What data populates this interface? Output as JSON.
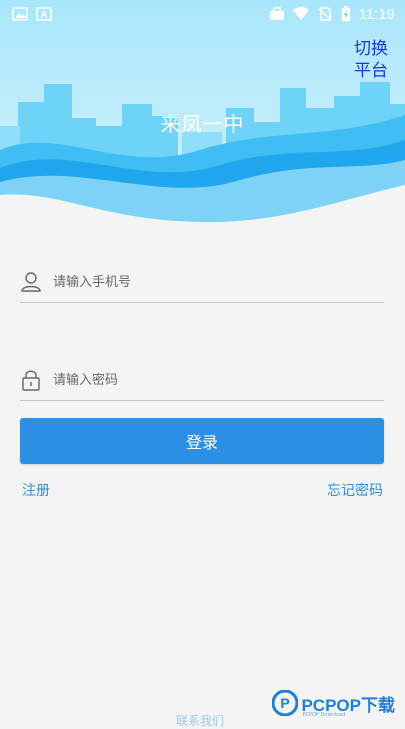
{
  "status_bar": {
    "time": "11:19",
    "icons": [
      "image-icon",
      "a-notification-icon",
      "briefcase-icon",
      "wifi-icon",
      "no-sim-icon",
      "battery-charging-icon"
    ]
  },
  "header": {
    "title": "来凤一中",
    "switch_platform_label_1": "切换",
    "switch_platform_label_2": "平台"
  },
  "form": {
    "phone_placeholder": "请输入手机号",
    "password_placeholder": "请输入密码",
    "login_label": "登录",
    "register_label": "注册",
    "forgot_label": "忘记密码"
  },
  "footer": {
    "partial_text": "联系我们"
  },
  "watermark": {
    "brand": "PCPOP下载",
    "sub": "PCPOP Download"
  },
  "colors": {
    "primary": "#2b8fe4",
    "link": "#2a8fd8",
    "switch_text": "#1b36c9",
    "sky_light": "#c4eefc",
    "building": "#54c8f5"
  }
}
